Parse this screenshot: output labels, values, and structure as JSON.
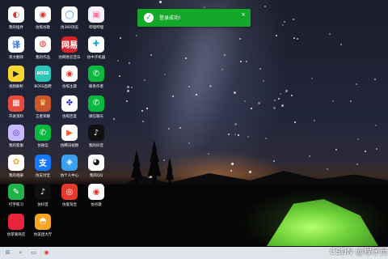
{
  "desktop_icons": [
    {
      "label": "我的插件",
      "glyph": "◐",
      "color": "#ffffff",
      "fg": "#e2322b"
    },
    {
      "label": "仿照谷歌",
      "glyph": "◉",
      "color": "#ffffff",
      "fg": "#e2322b"
    },
    {
      "label": "仿360浏览",
      "glyph": "◯",
      "color": "#ffffff",
      "fg": "#2a8ef0"
    },
    {
      "label": "哔哩哔哩",
      "glyph": "▣",
      "color": "#f6f0fb",
      "fg": "#fb7299"
    },
    {
      "label": "英文翻译",
      "glyph": "译",
      "color": "#ffffff",
      "fg": "#2f6df0"
    },
    {
      "label": "我的作品",
      "glyph": "◍",
      "color": "#ffffff",
      "fg": "#e2322b"
    },
    {
      "label": "仿网易云音乐",
      "glyph": "网易",
      "color": "#d7242a",
      "fg": "#ffffff"
    },
    {
      "label": "仿中子机器",
      "glyph": "✚",
      "color": "#ffffff",
      "fg": "#19a7d8"
    },
    {
      "label": "视频解析",
      "glyph": "▶",
      "color": "#f8d531",
      "fg": "#222222"
    },
    {
      "label": "BOSS直聘",
      "glyph": "BOSS",
      "color": "#2bc6b7",
      "fg": "#ffffff"
    },
    {
      "label": "仿照主题",
      "glyph": "◉",
      "color": "#ffffff",
      "fg": "#e2322b"
    },
    {
      "label": "联系作者",
      "glyph": "✆",
      "color": "#09b83e",
      "fg": "#ffffff"
    },
    {
      "label": "开发资料",
      "glyph": "▦",
      "color": "#e84b3c",
      "fg": "#ffffff"
    },
    {
      "label": "王者荣耀",
      "glyph": "♛",
      "color": "#c9592c",
      "fg": "#ffe08a"
    },
    {
      "label": "仿照百度",
      "glyph": "✤",
      "color": "#ffffff",
      "fg": "#2932e1"
    },
    {
      "label": "微信聊天",
      "glyph": "✆",
      "color": "#09b83e",
      "fg": "#ffffff"
    },
    {
      "label": "我的客服",
      "glyph": "◎",
      "color": "#c8b8ff",
      "fg": "#5a3cc8"
    },
    {
      "label": "仿微信",
      "glyph": "✆",
      "color": "#09b83e",
      "fg": "#ffffff"
    },
    {
      "label": "仿腾讯视频",
      "glyph": "▶",
      "color": "#ffffff",
      "fg": "#ff5a2b"
    },
    {
      "label": "我的抖音",
      "glyph": "♪",
      "color": "#111111",
      "fg": "#ffffff"
    },
    {
      "label": "我的相册",
      "glyph": "✿",
      "color": "#ffffff",
      "fg": "#f5a623"
    },
    {
      "label": "仿支付宝",
      "glyph": "支",
      "color": "#1677ff",
      "fg": "#ffffff"
    },
    {
      "label": "仿个人中心",
      "glyph": "◈",
      "color": "#3aa0f0",
      "fg": "#ffffff"
    },
    {
      "label": "我的QQ",
      "glyph": "◕",
      "color": "#ffffff",
      "fg": "#111111"
    },
    {
      "label": "打字练习",
      "glyph": "✎",
      "color": "#22b24c",
      "fg": "#ffffff"
    },
    {
      "label": "仿抖音",
      "glyph": "♪",
      "color": "#111111",
      "fg": "#ffffff"
    },
    {
      "label": "仿爱淘宝",
      "glyph": "◎",
      "color": "#e83a2c",
      "fg": "#ffffff"
    },
    {
      "label": "仿谷歌",
      "glyph": "◉",
      "color": "#ffffff",
      "fg": "#e2322b"
    },
    {
      "label": "仿苹果商店",
      "glyph": "",
      "color": "#e8243a",
      "fg": "#ffffff"
    },
    {
      "label": "仿美团大厅",
      "glyph": "◓",
      "color": "#f5a623",
      "fg": "#ffffff"
    }
  ],
  "toast": {
    "message": "登录成功!",
    "close": "×",
    "check": "✓"
  },
  "taskbar": [
    {
      "name": "start-button",
      "glyph": "⊞",
      "color": "#2b7fd6"
    },
    {
      "name": "search-icon",
      "glyph": "⌕",
      "color": "#555555"
    },
    {
      "name": "taskview-icon",
      "glyph": "▭",
      "color": "#555555"
    },
    {
      "name": "browser-icon",
      "glyph": "◉",
      "color": "#e2322b"
    }
  ],
  "watermark": "CSDN @程序员"
}
